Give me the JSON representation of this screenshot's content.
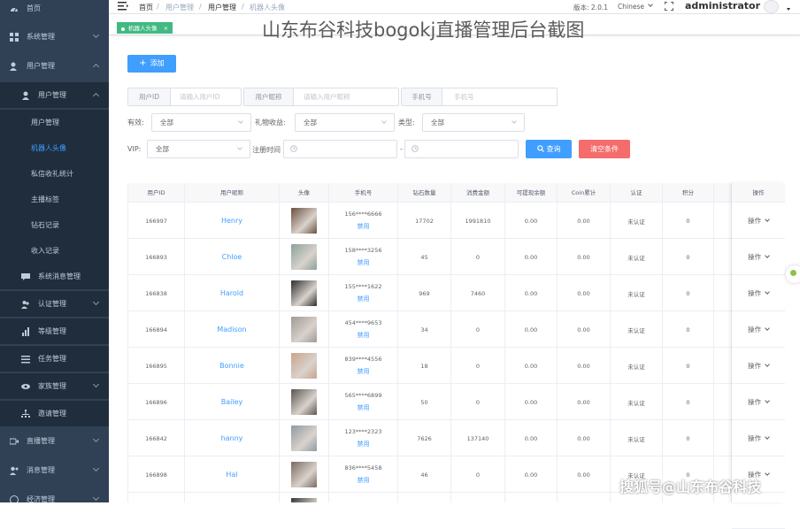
{
  "sidebar": {
    "items": [
      {
        "label": "首页",
        "icon": "dashboard-icon"
      },
      {
        "label": "系统管理",
        "icon": "grid-icon"
      },
      {
        "label": "用户管理",
        "icon": "user-icon"
      },
      {
        "label": "用户管理",
        "icon": "user-icon"
      },
      {
        "label": "用户管理"
      },
      {
        "label": "机器人头像"
      },
      {
        "label": "私信收礼统计"
      },
      {
        "label": "主播标签"
      },
      {
        "label": "钻石记录"
      },
      {
        "label": "收入记录"
      },
      {
        "label": "系统消息管理",
        "icon": "message-icon"
      },
      {
        "label": "认证管理",
        "icon": "people-icon"
      },
      {
        "label": "等级管理",
        "icon": "bar-chart-icon"
      },
      {
        "label": "任务管理",
        "icon": "list-icon"
      },
      {
        "label": "家族管理",
        "icon": "eye-icon"
      },
      {
        "label": "邀请管理",
        "icon": "tree-icon"
      },
      {
        "label": "直播管理",
        "icon": "video-icon"
      },
      {
        "label": "消息管理",
        "icon": "chat-icon"
      },
      {
        "label": "经济管理",
        "icon": "money-icon"
      }
    ]
  },
  "header": {
    "breadcrumb": [
      "首页",
      "用户管理",
      "用户管理",
      "机器人头像"
    ],
    "version": "版本: 2.0.1",
    "language": "Chinese",
    "username": "administrator",
    "tag_label": "机器人头像"
  },
  "overlay_title": "山东布谷科技bogokj直播管理后台截图",
  "watermark": "搜狐号@山东布谷科技",
  "toolbar": {
    "add_label": "添加"
  },
  "filters": {
    "uid_label": "用户ID",
    "uid_placeholder": "请输入用户ID",
    "nick_label": "用户昵称",
    "nick_placeholder": "请输入用户昵称",
    "phone_label": "手机号",
    "phone_placeholder": "手机号",
    "valid_label": "有效:",
    "valid_value": "全部",
    "gift_label": "礼物收益:",
    "gift_value": "全部",
    "type_label": "类型:",
    "type_value": "全部",
    "vip_label": "VIP:",
    "vip_value": "全部",
    "regtime_label": "注册时间",
    "dash": "-",
    "query_label": "查询",
    "clear_label": "清空条件"
  },
  "table": {
    "headers": [
      "用户ID",
      "用户昵称",
      "头像",
      "手机号",
      "钻石数量",
      "消费金额",
      "可提现余额",
      "Coin累计",
      "认证",
      "积分",
      "",
      "操作"
    ],
    "ban_label": "禁用",
    "op_label": "操作",
    "rows": [
      {
        "id": "166997",
        "nick": "Henry",
        "phone": "156****6666",
        "diamonds": "17702",
        "spend": "1991810",
        "balance": "0.00",
        "coin": "0.00",
        "auth": "未认证",
        "points": "0",
        "avatar_color": "#6b4f3f"
      },
      {
        "id": "166893",
        "nick": "Chloe",
        "phone": "158****3256",
        "diamonds": "45",
        "spend": "0",
        "balance": "0.00",
        "coin": "0.00",
        "auth": "未认证",
        "points": "0",
        "avatar_color": "#8aa19a"
      },
      {
        "id": "166838",
        "nick": "Harold",
        "phone": "155****1622",
        "diamonds": "969",
        "spend": "7460",
        "balance": "0.00",
        "coin": "0.00",
        "auth": "未认证",
        "points": "0",
        "avatar_color": "#2e2e2e"
      },
      {
        "id": "166894",
        "nick": "Madison",
        "phone": "454****9653",
        "diamonds": "34",
        "spend": "0",
        "balance": "0.00",
        "coin": "0.00",
        "auth": "未认证",
        "points": "0",
        "avatar_color": "#a09a94"
      },
      {
        "id": "166895",
        "nick": "Bonnie",
        "phone": "839****4556",
        "diamonds": "18",
        "spend": "0",
        "balance": "0.00",
        "coin": "0.00",
        "auth": "未认证",
        "points": "0",
        "avatar_color": "#c8a48c"
      },
      {
        "id": "166896",
        "nick": "Bailey",
        "phone": "565****6899",
        "diamonds": "50",
        "spend": "0",
        "balance": "0.00",
        "coin": "0.00",
        "auth": "未认证",
        "points": "0",
        "avatar_color": "#5a5552"
      },
      {
        "id": "166842",
        "nick": "hanny",
        "phone": "123****2323",
        "diamonds": "7626",
        "spend": "137140",
        "balance": "0.00",
        "coin": "0.00",
        "auth": "未认证",
        "points": "0",
        "avatar_color": "#8f9aa3"
      },
      {
        "id": "166898",
        "nick": "Hal",
        "phone": "836****5458",
        "diamonds": "46",
        "spend": "0",
        "balance": "0.00",
        "coin": "0.00",
        "auth": "未认证",
        "points": "0",
        "avatar_color": "#7a6a60"
      },
      {
        "id": "",
        "nick": "",
        "phone": "",
        "diamonds": "",
        "spend": "",
        "balance": "",
        "coin": "",
        "auth": "",
        "points": "",
        "avatar_color": "#333333"
      }
    ]
  },
  "colors": {
    "sidebar_bg": "#304156",
    "sidebar_sub_bg": "#1f2d3d",
    "primary": "#409eff",
    "danger": "#f56c6c",
    "tag": "#42b983"
  }
}
